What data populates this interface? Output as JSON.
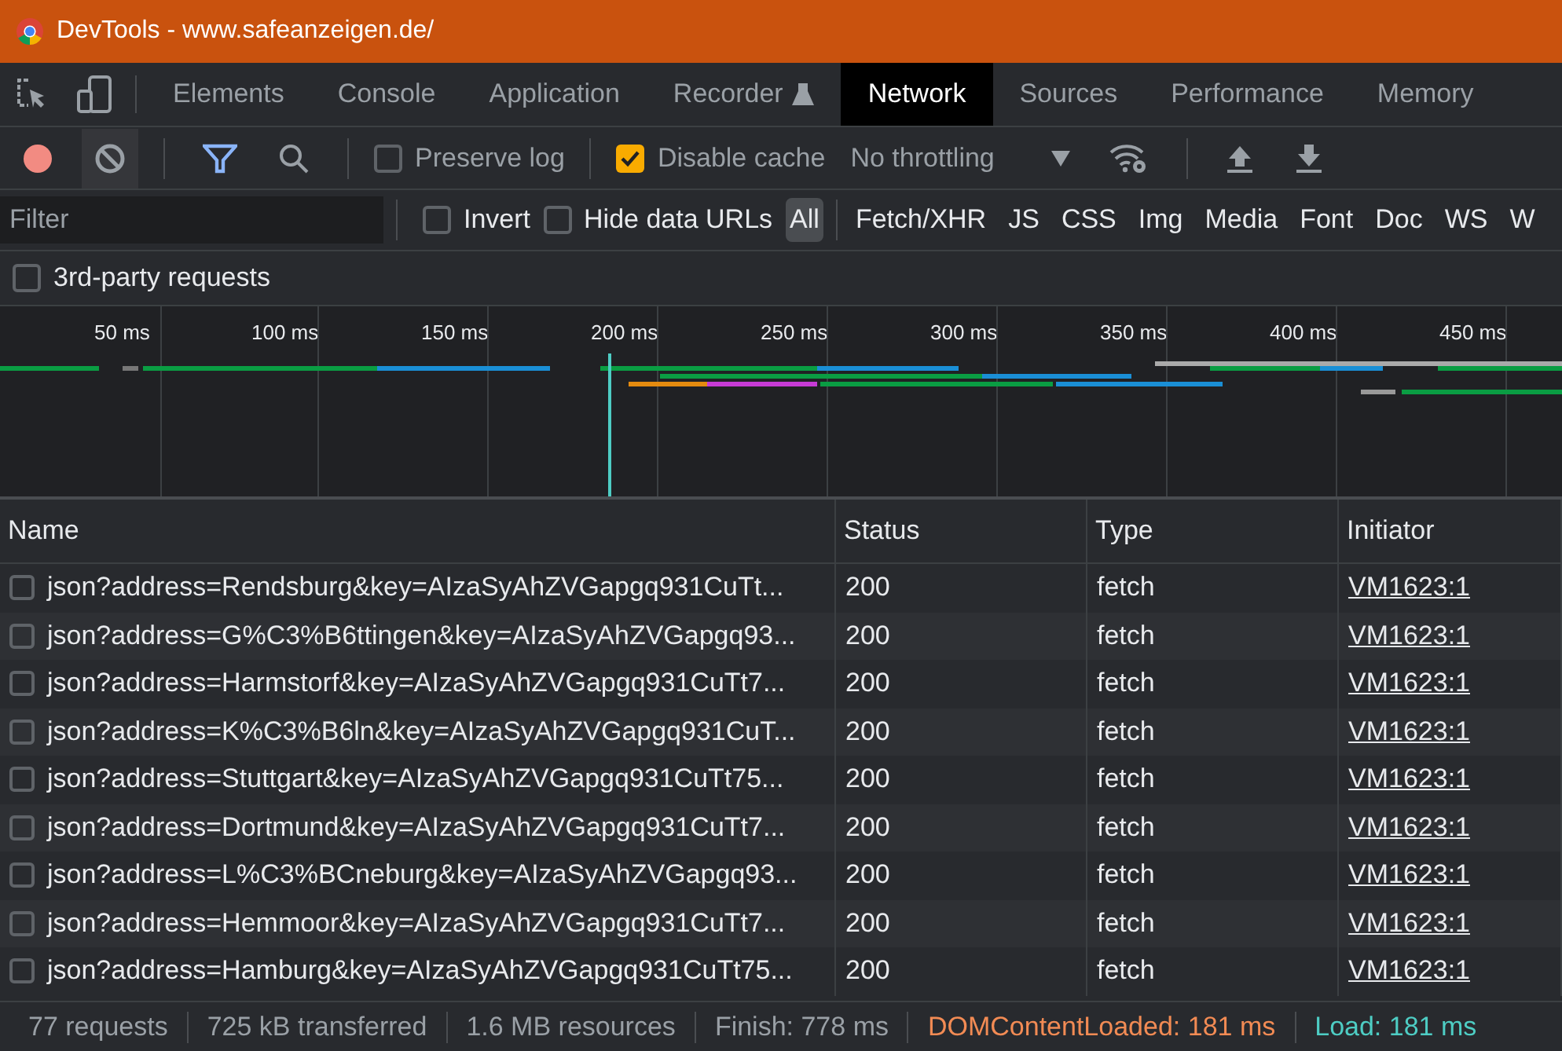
{
  "window": {
    "title": "DevTools - www.safeanzeigen.de/"
  },
  "tabs": [
    {
      "label": "Elements",
      "selected": false
    },
    {
      "label": "Console",
      "selected": false
    },
    {
      "label": "Application",
      "selected": false
    },
    {
      "label": "Recorder",
      "selected": false,
      "kind": "experimental"
    },
    {
      "label": "Network",
      "selected": true
    },
    {
      "label": "Sources",
      "selected": false
    },
    {
      "label": "Performance",
      "selected": false
    },
    {
      "label": "Memory",
      "selected": false
    }
  ],
  "toolbar": {
    "preserve_log": {
      "label": "Preserve log",
      "checked": false
    },
    "disable_cache": {
      "label": "Disable cache",
      "checked": true
    },
    "throttling": "No throttling"
  },
  "filter": {
    "placeholder": "Filter",
    "invert": {
      "label": "Invert",
      "checked": false
    },
    "hide_data_urls": {
      "label": "Hide data URLs",
      "checked": false
    },
    "types": [
      {
        "label": "All",
        "selected": true
      },
      {
        "label": "Fetch/XHR",
        "selected": false
      },
      {
        "label": "JS",
        "selected": false
      },
      {
        "label": "CSS",
        "selected": false
      },
      {
        "label": "Img",
        "selected": false
      },
      {
        "label": "Media",
        "selected": false
      },
      {
        "label": "Font",
        "selected": false
      },
      {
        "label": "Doc",
        "selected": false
      },
      {
        "label": "WS",
        "selected": false
      },
      {
        "label": "W",
        "selected": false
      }
    ],
    "third_party": {
      "label": "3rd-party requests",
      "checked": false
    }
  },
  "overview": {
    "ticks": [
      "50 ms",
      "100 ms",
      "150 ms",
      "200 ms",
      "250 ms",
      "300 ms",
      "350 ms",
      "400 ms",
      "450 ms"
    ]
  },
  "table": {
    "columns": [
      "Name",
      "Status",
      "Type",
      "Initiator"
    ],
    "rows": [
      {
        "name": "json?address=Rendsburg&key=AIzaSyAhZVGapgq931CuTt...",
        "status": "200",
        "type": "fetch",
        "initiator": "VM1623:1"
      },
      {
        "name": "json?address=G%C3%B6ttingen&key=AIzaSyAhZVGapgq93...",
        "status": "200",
        "type": "fetch",
        "initiator": "VM1623:1"
      },
      {
        "name": "json?address=Harmstorf&key=AIzaSyAhZVGapgq931CuTt7...",
        "status": "200",
        "type": "fetch",
        "initiator": "VM1623:1"
      },
      {
        "name": "json?address=K%C3%B6ln&key=AIzaSyAhZVGapgq931CuT...",
        "status": "200",
        "type": "fetch",
        "initiator": "VM1623:1"
      },
      {
        "name": "json?address=Stuttgart&key=AIzaSyAhZVGapgq931CuTt75...",
        "status": "200",
        "type": "fetch",
        "initiator": "VM1623:1"
      },
      {
        "name": "json?address=Dortmund&key=AIzaSyAhZVGapgq931CuTt7...",
        "status": "200",
        "type": "fetch",
        "initiator": "VM1623:1"
      },
      {
        "name": "json?address=L%C3%BCneburg&key=AIzaSyAhZVGapgq93...",
        "status": "200",
        "type": "fetch",
        "initiator": "VM1623:1"
      },
      {
        "name": "json?address=Hemmoor&key=AIzaSyAhZVGapgq931CuTt7...",
        "status": "200",
        "type": "fetch",
        "initiator": "VM1623:1"
      },
      {
        "name": "json?address=Hamburg&key=AIzaSyAhZVGapgq931CuTt75...",
        "status": "200",
        "type": "fetch",
        "initiator": "VM1623:1"
      }
    ]
  },
  "status_bar": [
    {
      "text": "77 requests",
      "kind": "plain"
    },
    {
      "text": "725 kB transferred",
      "kind": "plain"
    },
    {
      "text": "1.6 MB resources",
      "kind": "plain"
    },
    {
      "text": "Finish: 778 ms",
      "kind": "plain"
    },
    {
      "text": "DOMContentLoaded: 181 ms",
      "kind": "dom"
    },
    {
      "text": "Load: 181 ms",
      "kind": "load"
    }
  ]
}
